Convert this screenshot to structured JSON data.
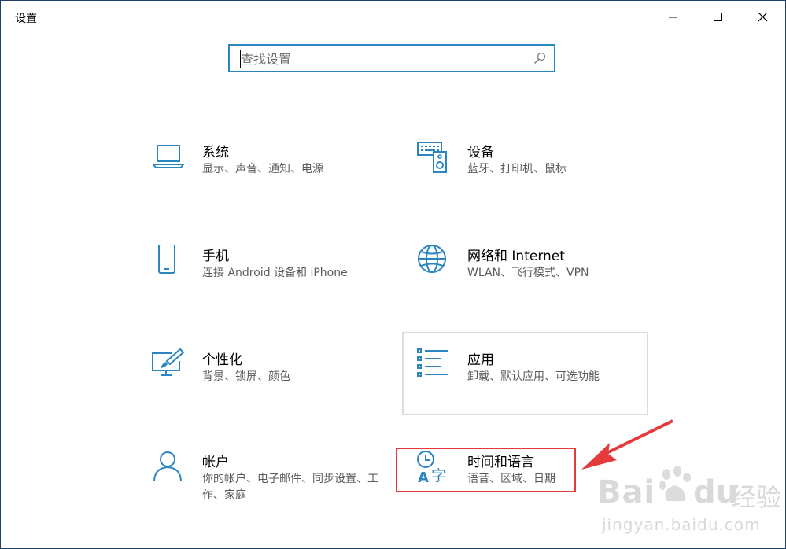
{
  "window": {
    "title": "设置"
  },
  "search": {
    "placeholder": "查找设置"
  },
  "colors": {
    "accent": "#2b86c0",
    "highlight": "#e53a3a"
  },
  "tiles": [
    {
      "name": "系统",
      "desc": "显示、声音、通知、电源",
      "icon": "laptop-icon"
    },
    {
      "name": "设备",
      "desc": "蓝牙、打印机、鼠标",
      "icon": "keyboard-speaker-icon"
    },
    {
      "name": "手机",
      "desc": "连接 Android 设备和 iPhone",
      "icon": "phone-icon"
    },
    {
      "name": "网络和 Internet",
      "desc": "WLAN、飞行模式、VPN",
      "icon": "globe-icon"
    },
    {
      "name": "个性化",
      "desc": "背景、锁屏、颜色",
      "icon": "paint-monitor-icon"
    },
    {
      "name": "应用",
      "desc": "卸载、默认应用、可选功能",
      "icon": "list-icon"
    },
    {
      "name": "帐户",
      "desc": "你的帐户、电子邮件、同步设置、工作、家庭",
      "icon": "person-icon"
    },
    {
      "name": "时间和语言",
      "desc": "语音、区域、日期",
      "icon": "time-language-icon"
    }
  ],
  "watermark": {
    "brand": "Bai",
    "brand2": "du",
    "cn": "经验",
    "url": "jingyan.baidu.com"
  }
}
